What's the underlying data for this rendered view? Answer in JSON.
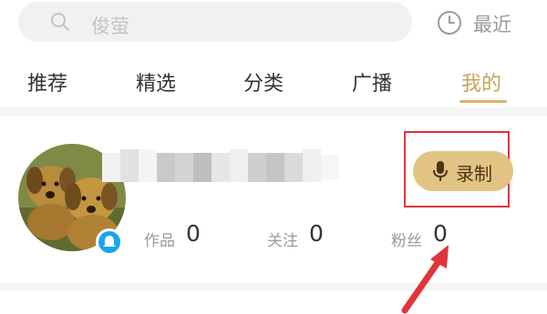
{
  "search": {
    "placeholder": "俊萤",
    "icon": "search-icon"
  },
  "recent": {
    "label": "最近",
    "icon": "clock-icon"
  },
  "tabs": [
    {
      "label": "推荐",
      "active": false
    },
    {
      "label": "精选",
      "active": false
    },
    {
      "label": "分类",
      "active": false
    },
    {
      "label": "广播",
      "active": false
    },
    {
      "label": "我的",
      "active": true
    }
  ],
  "profile": {
    "avatar_icon": "puppy-avatar",
    "badge_icon": "verified-badge-icon",
    "record": {
      "label": "录制",
      "icon": "microphone-icon"
    },
    "stats": [
      {
        "label": "作品",
        "value": "0"
      },
      {
        "label": "关注",
        "value": "0"
      },
      {
        "label": "粉丝",
        "value": "0"
      }
    ]
  },
  "colors": {
    "accent": "#c9a258",
    "record_button": "#e3c384",
    "highlight_box": "#e0343b",
    "badge": "#1aa5ec"
  }
}
